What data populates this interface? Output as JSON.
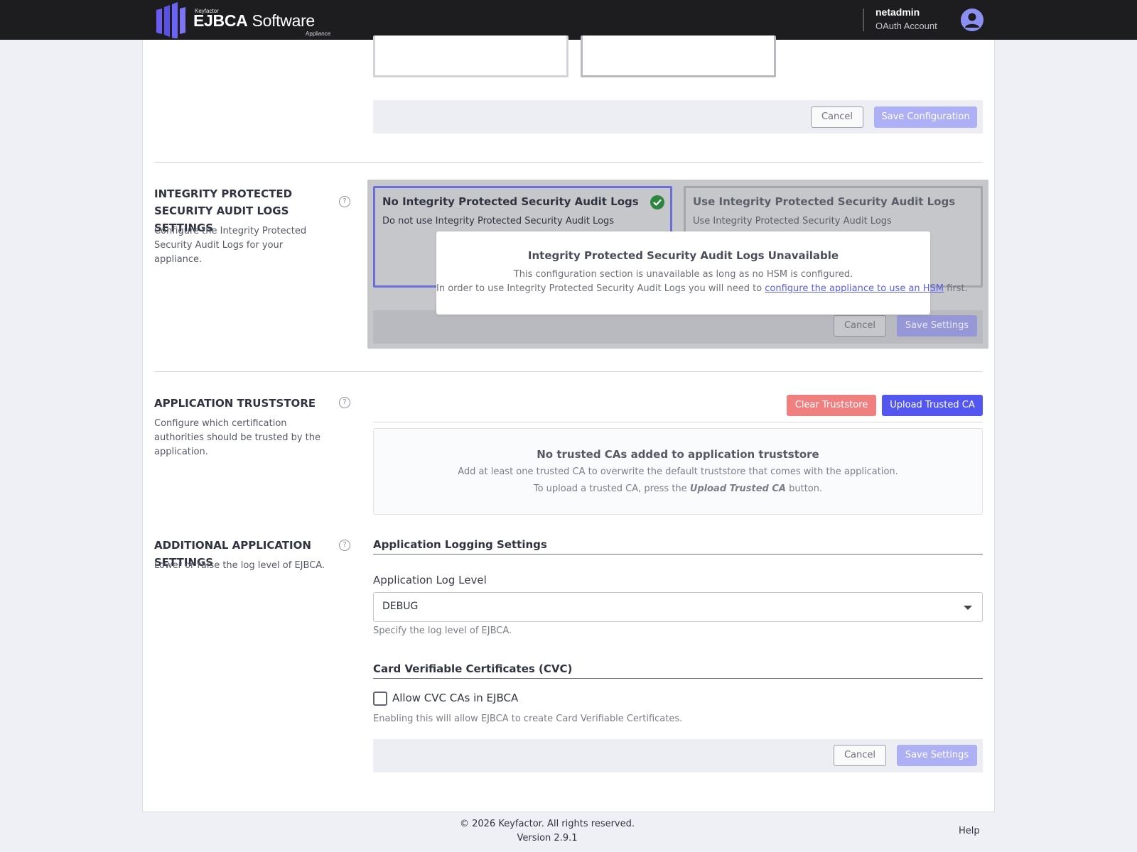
{
  "header": {
    "brand_small": "Keyfactor",
    "brand_title_bold": "EJBCA",
    "brand_title_rest": " Software",
    "brand_sub": "Appliance",
    "user_name": "netadmin",
    "user_account": "OAuth Account"
  },
  "top_section": {
    "cancel_label": "Cancel",
    "save_label": "Save Configuration"
  },
  "integrity": {
    "title": "INTEGRITY PROTECTED SECURITY AUDIT LOGS SETTINGS",
    "description": "Configure the Integrity Protected Security Audit Logs for your appliance.",
    "option_no_title": "No Integrity Protected Security Audit Logs",
    "option_no_desc": "Do not use Integrity Protected Security Audit Logs",
    "option_yes_title": "Use Integrity Protected Security Audit Logs",
    "option_yes_desc": "Use Integrity Protected Security Audit Logs",
    "modal_title": "Integrity Protected Security Audit Logs Unavailable",
    "modal_line1": "This configuration section is unavailable as long as no HSM is configured.",
    "modal_line2_pre": "In order to use Integrity Protected Security Audit Logs you will need to ",
    "modal_link": "configure the appliance to use an HSM",
    "modal_line2_post": " first.",
    "cancel_label": "Cancel",
    "save_label": "Save Settings"
  },
  "truststore": {
    "title": "APPLICATION TRUSTSTORE",
    "description": "Configure which certification authorities should be trusted by the application.",
    "clear_label": "Clear Truststore",
    "upload_label": "Upload Trusted CA",
    "empty_title": "No trusted CAs added to application truststore",
    "empty_line1": "Add at least one trusted CA to overwrite the default truststore that comes with the application.",
    "empty_line2_pre": "To upload a trusted CA, press the ",
    "empty_line2_em": "Upload Trusted CA",
    "empty_line2_post": " button."
  },
  "additional": {
    "title": "ADDITIONAL APPLICATION SETTINGS",
    "description": "Lower or raise the log level of EJBCA.",
    "logging_heading": "Application Logging Settings",
    "log_level_label": "Application Log Level",
    "log_level_value": "DEBUG",
    "log_level_hint": "Specify the log level of EJBCA.",
    "cvc_heading": "Card Verifiable Certificates (CVC)",
    "cvc_checkbox_label": "Allow CVC CAs in EJBCA",
    "cvc_checked": false,
    "cvc_hint": "Enabling this will allow EJBCA to create Card Verifiable Certificates.",
    "cancel_label": "Cancel",
    "save_label": "Save Settings"
  },
  "footer": {
    "copyright": "© 2026 Keyfactor. All rights reserved.",
    "version": "Version 2.9.1",
    "help": "Help"
  },
  "colors": {
    "accent": "#5357f0",
    "accent_disabled": "#aeb0f6",
    "danger": "#f08080",
    "success": "#2e8540",
    "header_bg": "#1d1d1f"
  }
}
